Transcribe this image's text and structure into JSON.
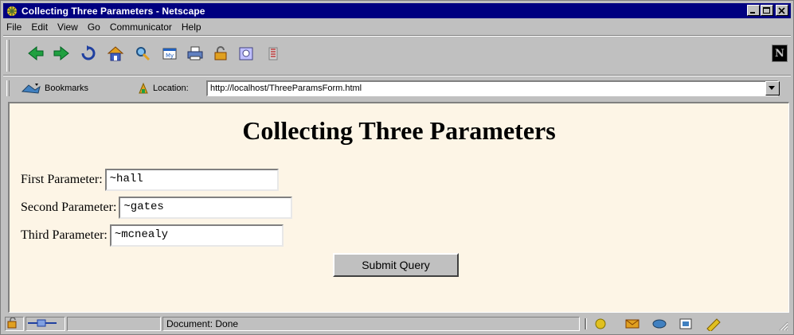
{
  "window": {
    "title": "Collecting Three Parameters - Netscape"
  },
  "menu": [
    "File",
    "Edit",
    "View",
    "Go",
    "Communicator",
    "Help"
  ],
  "toolbar": {
    "buttons": [
      "back-icon",
      "forward-icon",
      "reload-icon",
      "home-icon",
      "search-icon",
      "guide-icon",
      "print-icon",
      "security-icon",
      "shop-icon",
      "stop-icon"
    ],
    "logo": "N"
  },
  "locationbar": {
    "bookmarks_label": "Bookmarks",
    "location_label": "Location:",
    "url": "http://localhost/ThreeParamsForm.html"
  },
  "page": {
    "heading": "Collecting Three Parameters",
    "fields": [
      {
        "label": "First Parameter:",
        "value": "~hall"
      },
      {
        "label": "Second Parameter:",
        "value": "~gates"
      },
      {
        "label": "Third Parameter:",
        "value": "~mcnealy"
      }
    ],
    "submit_label": "Submit Query",
    "background_color": "#fdf5e6"
  },
  "status": {
    "text": "Document: Done"
  }
}
